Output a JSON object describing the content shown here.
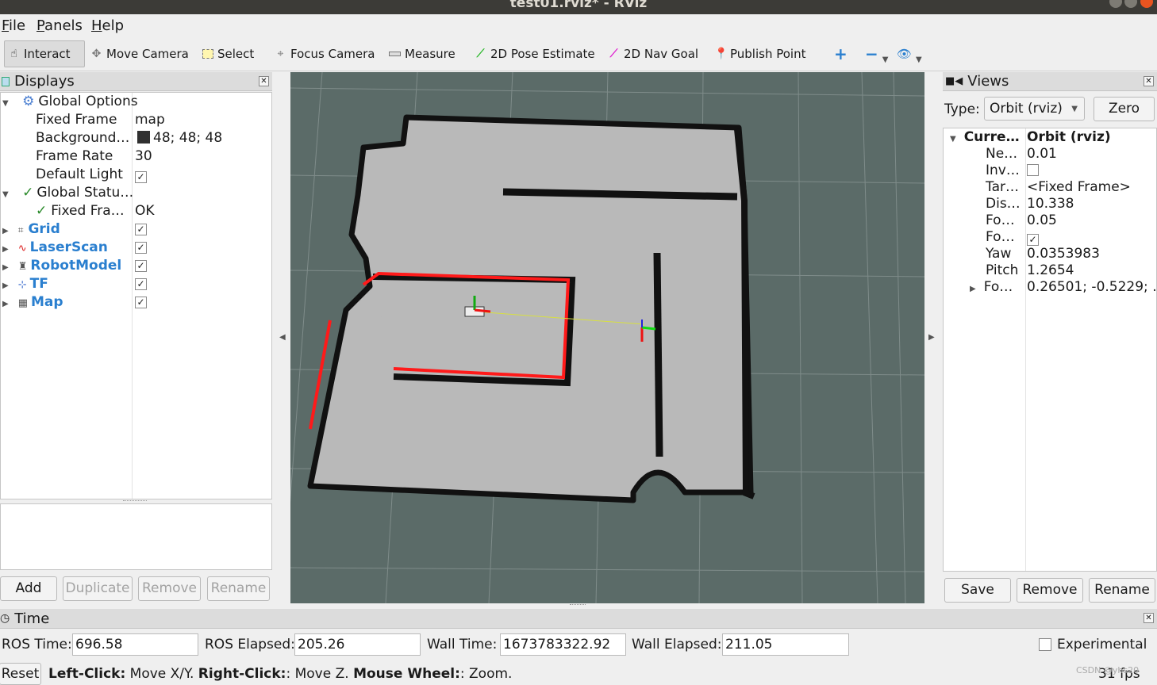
{
  "window": {
    "title": "test01.rviz* - RViz"
  },
  "menu": {
    "file": "F",
    "file_rest": "ile",
    "panels": "P",
    "panels_rest": "anels",
    "help": "H",
    "help_rest": "elp"
  },
  "toolbar": {
    "interact": "Interact",
    "move_camera": "Move Camera",
    "select": "Select",
    "focus_camera": "Focus Camera",
    "measure": "Measure",
    "pose_estimate": "2D Pose Estimate",
    "nav_goal": "2D Nav Goal",
    "publish_point": "Publish Point"
  },
  "displays": {
    "title": "Displays",
    "global_options": "Global Options",
    "fixed_frame_label": "Fixed Frame",
    "fixed_frame_value": "map",
    "background_label": "Background…",
    "background_value": "48; 48; 48",
    "background_swatch": "#303030",
    "frame_rate_label": "Frame Rate",
    "frame_rate_value": "30",
    "default_light_label": "Default Light",
    "default_light_checked": true,
    "global_status": "Global Statu…",
    "fixed_frame_status_label": "Fixed Fra…",
    "fixed_frame_status_value": "OK",
    "items": [
      {
        "label": "Grid",
        "icon": "grid-icon",
        "checked": true
      },
      {
        "label": "LaserScan",
        "icon": "laserscan-icon",
        "checked": true
      },
      {
        "label": "RobotModel",
        "icon": "robot-icon",
        "checked": true
      },
      {
        "label": "TF",
        "icon": "tf-icon",
        "checked": true
      },
      {
        "label": "Map",
        "icon": "map-icon",
        "checked": true
      }
    ],
    "buttons": {
      "add": "Add",
      "duplicate": "Duplicate",
      "remove": "Remove",
      "rename": "Rename"
    }
  },
  "views": {
    "title": "Views",
    "type_label": "Type:",
    "type_value": "Orbit (rviz)",
    "zero": "Zero",
    "current_label": "Curre…",
    "current_value": "Orbit (rviz)",
    "props": [
      {
        "label": "Ne…",
        "value": "0.01"
      },
      {
        "label": "Inv…",
        "value": "",
        "checkbox": false
      },
      {
        "label": "Tar…",
        "value": "<Fixed Frame>"
      },
      {
        "label": "Dis…",
        "value": "10.338"
      },
      {
        "label": "Fo…",
        "value": "0.05"
      },
      {
        "label": "Fo…",
        "value": "",
        "checkbox": true
      },
      {
        "label": "Yaw",
        "value": "0.0353983"
      },
      {
        "label": "Pitch",
        "value": "1.2654"
      },
      {
        "label": "Fo…",
        "value": "0.26501; -0.5229; …"
      }
    ],
    "buttons": {
      "save": "Save",
      "remove": "Remove",
      "rename": "Rename"
    }
  },
  "time": {
    "title": "Time",
    "ros_time_label": "ROS Time:",
    "ros_time": "696.58",
    "ros_elapsed_label": "ROS Elapsed:",
    "ros_elapsed": "205.26",
    "wall_time_label": "Wall Time:",
    "wall_time": "1673783322.92",
    "wall_elapsed_label": "Wall Elapsed:",
    "wall_elapsed": "211.05",
    "experimental": "Experimental"
  },
  "status": {
    "reset": "Reset",
    "left_click": "Left-Click:",
    "left_click_desc": "Move X/Y.",
    "right_click": "Right-Click:",
    "right_click_desc": ": Move Z.",
    "wheel": "Mouse Wheel:",
    "wheel_desc": ": Zoom.",
    "fps": "31 fps",
    "watermark": "CSDN @yhs20"
  },
  "colors": {
    "viewport_bg": "#5b6b68",
    "map_free": "#b9b9b9",
    "map_wall": "#111111",
    "laser": "#ff1a1a"
  }
}
